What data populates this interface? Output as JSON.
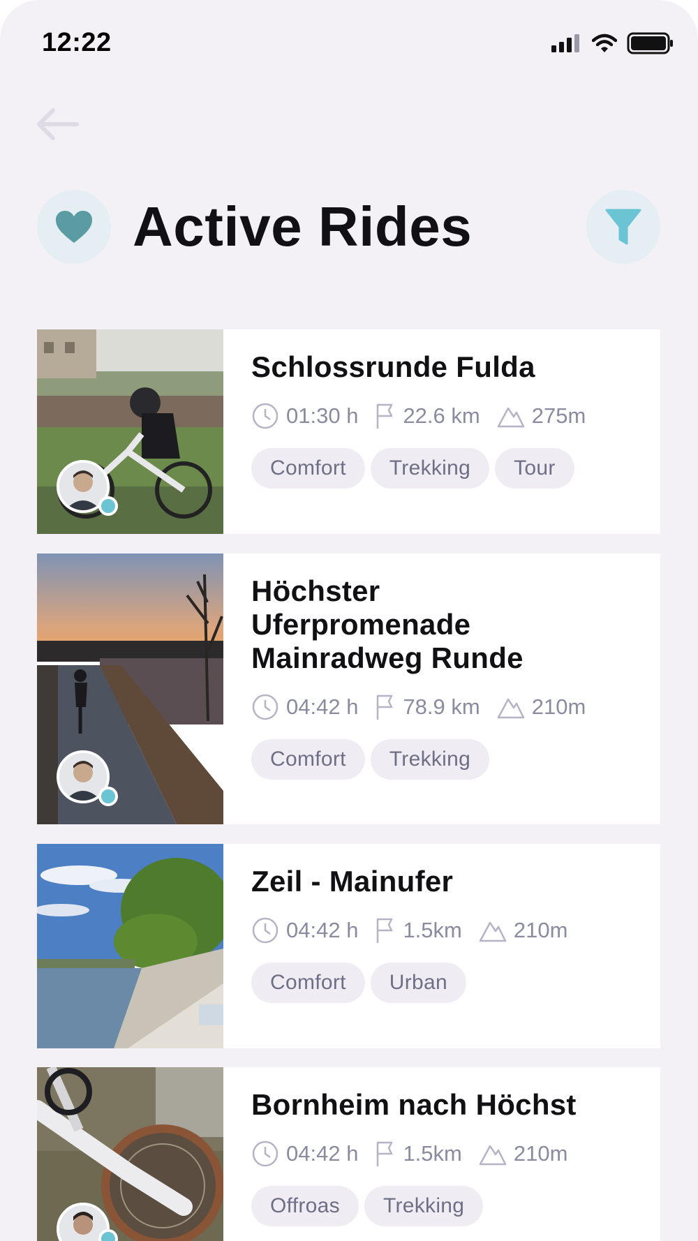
{
  "status_bar": {
    "time": "12:22"
  },
  "header": {
    "title": "Active Rides",
    "back_icon": "arrow-left-icon",
    "favorite_icon": "heart-icon",
    "filter_icon": "filter-icon",
    "accent_color": "#5b9ba3",
    "filter_color": "#6ac4d4"
  },
  "rides": [
    {
      "title": "Schlossrunde Fulda",
      "duration": "01:30 h",
      "distance": "22.6 km",
      "elevation": "275m",
      "tags": [
        "Comfort",
        "Trekking",
        "Tour"
      ],
      "has_avatar": true
    },
    {
      "title": "Höchster Uferpromenade Mainradweg Runde",
      "duration": "04:42 h",
      "distance": "78.9 km",
      "elevation": "210m",
      "tags": [
        "Comfort",
        "Trekking"
      ],
      "has_avatar": true
    },
    {
      "title": "Zeil - Mainufer",
      "duration": "04:42 h",
      "distance": "1.5km",
      "elevation": "210m",
      "tags": [
        "Comfort",
        "Urban"
      ],
      "has_avatar": false
    },
    {
      "title": "Bornheim nach Höchst",
      "duration": "04:42 h",
      "distance": "1.5km",
      "elevation": "210m",
      "tags": [
        "Offroas",
        "Trekking"
      ],
      "has_avatar": true
    }
  ]
}
